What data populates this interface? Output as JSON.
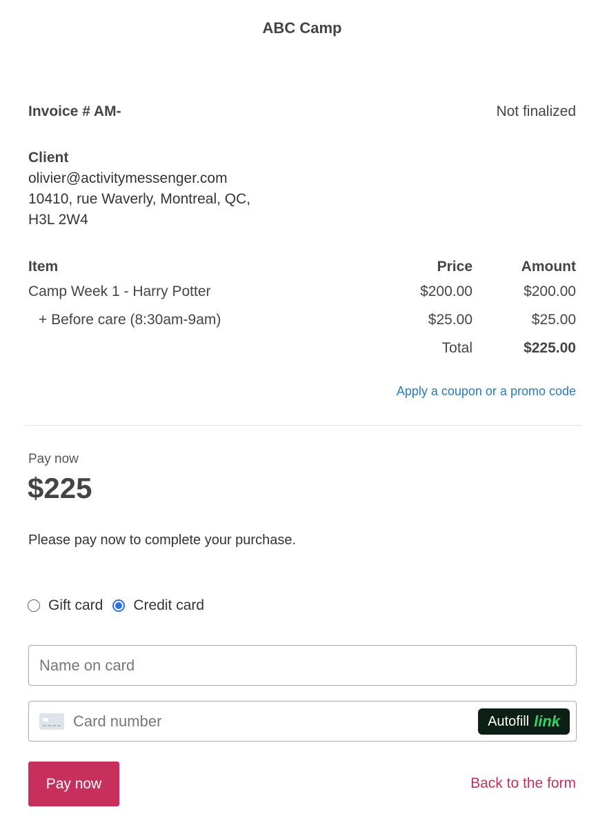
{
  "header": {
    "title": "ABC Camp"
  },
  "invoice": {
    "number": "Invoice # AM-",
    "status": "Not finalized"
  },
  "client": {
    "heading": "Client",
    "email": "olivier@activitymessenger.com",
    "address_line1": "10410, rue Waverly, Montreal, QC,",
    "address_line2": "H3L 2W4"
  },
  "items_table": {
    "columns": [
      "Item",
      "Price",
      "Amount"
    ],
    "rows": [
      {
        "item": "Camp Week 1 - Harry Potter",
        "price": "$200.00",
        "amount": "$200.00"
      },
      {
        "item": "+ Before care (8:30am-9am)",
        "price": "$25.00",
        "amount": "$25.00"
      }
    ],
    "total_label": "Total",
    "total_amount": "$225.00"
  },
  "coupon_link": "Apply a coupon or a promo code",
  "payment": {
    "label": "Pay now",
    "amount": "$225",
    "note": "Please pay now to complete your purchase.",
    "methods": [
      {
        "label": "Gift card",
        "selected": false
      },
      {
        "label": "Credit card",
        "selected": true
      }
    ],
    "name_placeholder": "Name on card",
    "card_placeholder": "Card number",
    "autofill_text": "Autofill",
    "autofill_brand": "link",
    "autofill_brand_color": "#34d16a",
    "pay_button": "Pay now",
    "back_link": "Back to the form",
    "accent_color": "#c7305d",
    "link_color": "#2a7ab8"
  }
}
